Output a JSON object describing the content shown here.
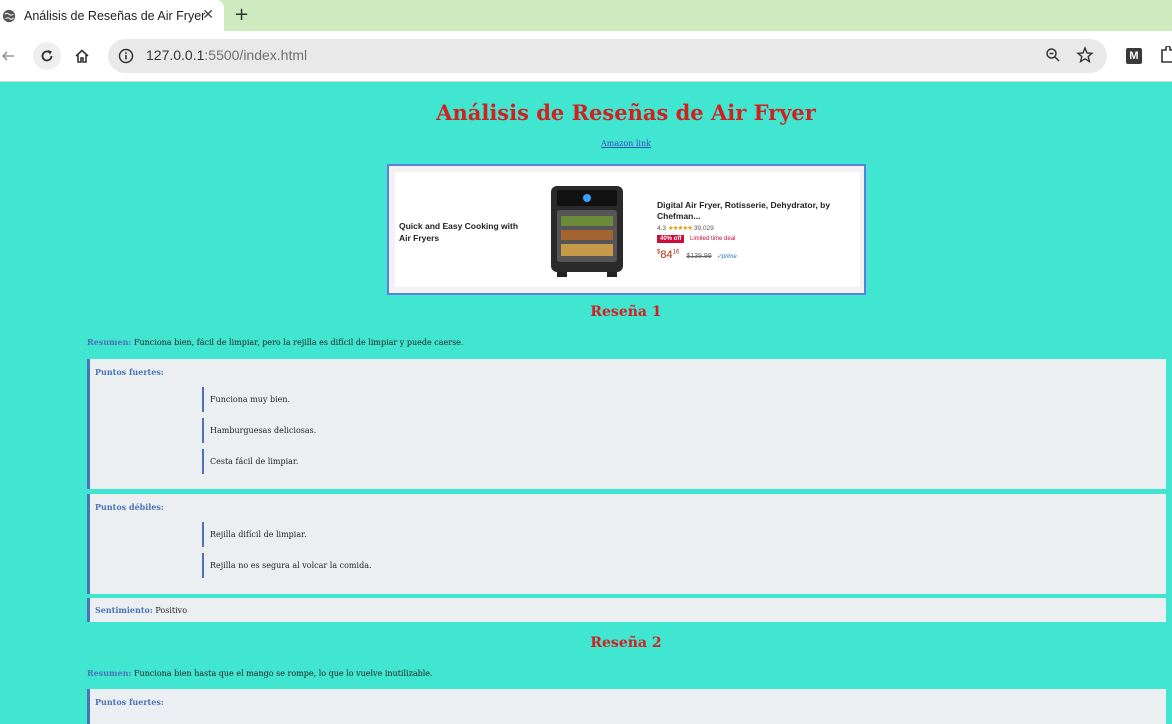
{
  "browser": {
    "tab_title": "Análisis de Reseñas de Air Fryer",
    "tab_close": "✕",
    "new_tab": "+",
    "url_host": "127.0.0.1",
    "url_rest": ":5500/index.html",
    "extension_label": "M"
  },
  "page": {
    "title": "Análisis de Reseñas de Air Fryer",
    "amazon_link": "Amazon link"
  },
  "ad": {
    "headline": "Quick and Easy Cooking with Air Fryers",
    "product_name": "Digital Air Fryer, Rotisserie, Dehydrator, by Chefman...",
    "rating_value": "4.3",
    "stars": "★★★★★",
    "rating_count": "39,029",
    "discount_badge": "40% off",
    "deal_text": "Limited time deal",
    "price_dollar": "$",
    "price_whole": "84",
    "price_cents": "16",
    "price_old": "$139.99",
    "prime": "✓prime"
  },
  "labels": {
    "summary": "Resumen:",
    "strengths": "Puntos fuertes:",
    "weaknesses": "Puntos débiles:",
    "sentiment": "Sentimiento:"
  },
  "reviews": [
    {
      "title": "Reseña 1",
      "summary": "Funciona bien, fácil de limpiar, pero la rejilla es difícil de limpiar y puede caerse.",
      "strengths": [
        "Funciona muy bien.",
        "Hamburguesas deliciosas.",
        "Cesta fácil de limpiar."
      ],
      "weaknesses": [
        "Rejilla difícil de limpiar.",
        "Rejilla no es segura al volcar la comida."
      ],
      "sentiment": "Positivo"
    },
    {
      "title": "Reseña 2",
      "summary": "Funciona bien hasta que el mango se rompe, lo que lo vuelve inutilizable."
    }
  ]
}
